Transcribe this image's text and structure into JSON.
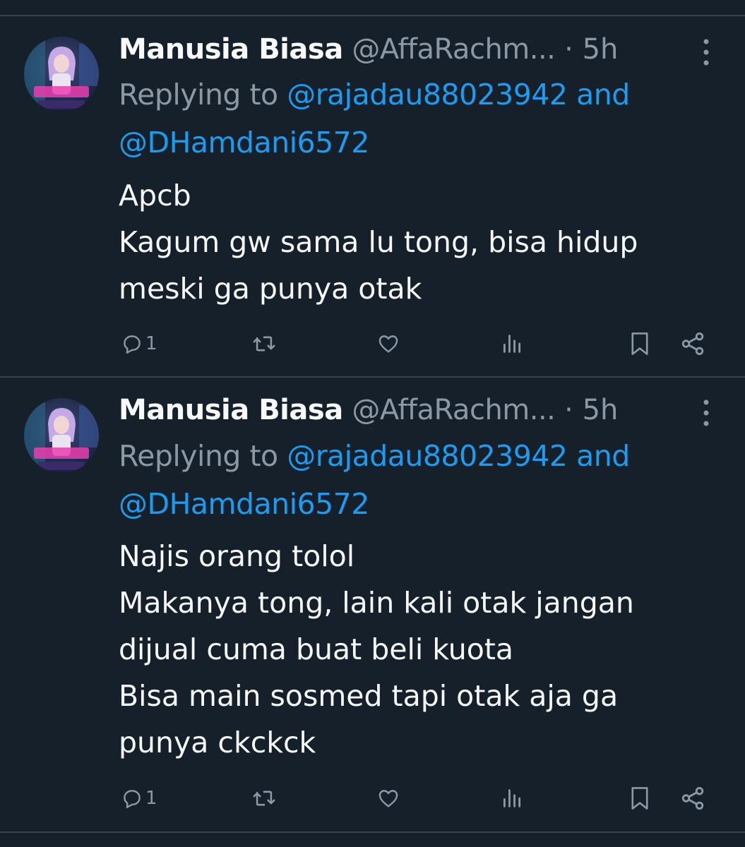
{
  "tweets": [
    {
      "display_name": "Manusia Biasa",
      "handle": "@AffaRachm...",
      "separator": "·",
      "time": "5h",
      "replying_prefix": "Replying to",
      "reply_to_1": "@rajadau88023942",
      "reply_and": "and",
      "reply_to_2": "@DHamdani6572",
      "body_lines": [
        "Apcb",
        "Kagum gw sama lu tong, bisa hidup",
        "meski ga punya otak"
      ],
      "reply_count": "1"
    },
    {
      "display_name": "Manusia Biasa",
      "handle": "@AffaRachm...",
      "separator": "·",
      "time": "5h",
      "replying_prefix": "Replying to",
      "reply_to_1": "@rajadau88023942",
      "reply_and": "and",
      "reply_to_2": "@DHamdani6572",
      "body_lines": [
        "Najis orang tolol",
        "Makanya tong, lain kali otak jangan",
        "dijual cuma buat beli kuota",
        "Bisa main sosmed tapi otak aja ga",
        "punya ckckck"
      ],
      "reply_count": "1"
    }
  ],
  "icons": {
    "more": "more-vertical-icon",
    "reply": "reply-icon",
    "retweet": "retweet-icon",
    "like": "heart-icon",
    "views": "views-icon",
    "bookmark": "bookmark-icon",
    "share": "share-icon"
  },
  "colors": {
    "background": "#15202b",
    "divider": "#38444d",
    "text_primary": "#f7f9f9",
    "text_secondary": "#8b98a5",
    "link": "#1d9bf0"
  }
}
